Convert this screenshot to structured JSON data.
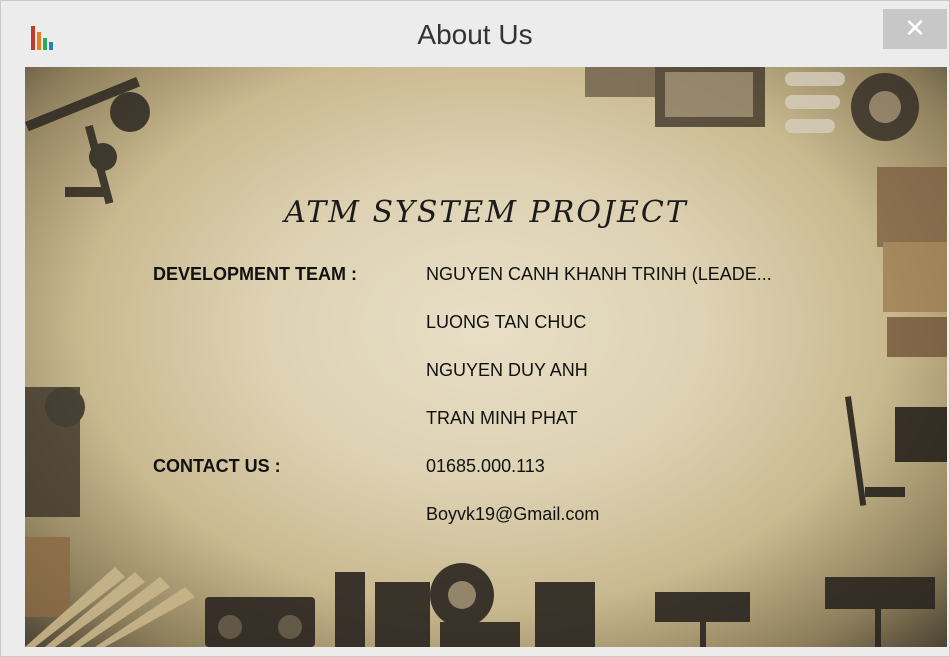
{
  "window": {
    "title": "About Us",
    "close_glyph": "✕"
  },
  "icons": {
    "app": "bar-chart-icon",
    "close": "close-icon"
  },
  "colors": {
    "titlebar": "#ececec",
    "close_button": "#c7c7c7",
    "text": "#111111"
  },
  "content": {
    "heading": "ATM SYSTEM PROJECT",
    "development_team": {
      "label": "DEVELOPMENT TEAM :",
      "members": [
        "NGUYEN CANH KHANH TRINH (LEADE...",
        "LUONG TAN CHUC",
        "NGUYEN DUY ANH",
        "TRAN MINH PHAT"
      ]
    },
    "contact": {
      "label": "CONTACT US :",
      "phone": "01685.000.113",
      "email": "Boyvk19@Gmail.com"
    }
  }
}
